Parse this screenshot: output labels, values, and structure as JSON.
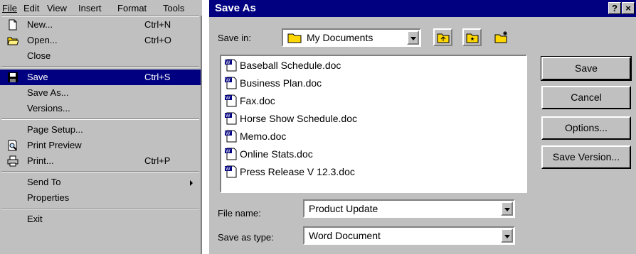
{
  "menubar": {
    "items": [
      "File",
      "Edit",
      "View",
      "Insert",
      "Format",
      "Tools"
    ]
  },
  "file_menu": {
    "items": [
      {
        "label": "New...",
        "shortcut": "Ctrl+N",
        "icon": "new-document-icon"
      },
      {
        "label": "Open...",
        "shortcut": "Ctrl+O",
        "icon": "open-folder-icon"
      },
      {
        "label": "Close",
        "shortcut": ""
      },
      {
        "label": "Save",
        "shortcut": "Ctrl+S",
        "icon": "floppy-disk-icon",
        "selected": true
      },
      {
        "label": "Save As...",
        "shortcut": ""
      },
      {
        "label": "Versions...",
        "shortcut": ""
      },
      {
        "label": "Page Setup...",
        "shortcut": ""
      },
      {
        "label": "Print Preview",
        "shortcut": "",
        "icon": "print-preview-icon"
      },
      {
        "label": "Print...",
        "shortcut": "Ctrl+P",
        "icon": "printer-icon"
      },
      {
        "label": "Send To",
        "shortcut": "",
        "submenu": true
      },
      {
        "label": "Properties",
        "shortcut": ""
      },
      {
        "label": "Exit",
        "shortcut": ""
      }
    ]
  },
  "dialog": {
    "title": "Save As",
    "help_button": "?",
    "close_button": "×",
    "save_in_label": "Save in:",
    "save_in_value": "My Documents",
    "files": [
      "Baseball Schedule.doc",
      "Business Plan.doc",
      "Fax.doc",
      "Horse Show Schedule.doc",
      "Memo.doc",
      "Online Stats.doc",
      "Press Release V 12.3.doc"
    ],
    "file_name_label": "File name:",
    "file_name_value": "Product Update",
    "save_type_label": "Save as type:",
    "save_type_value": "Word Document",
    "buttons": {
      "save": "Save",
      "cancel": "Cancel",
      "options": "Options...",
      "save_version": "Save Version..."
    }
  },
  "colors": {
    "menu_bg": "#c0c0c0",
    "selection": "#000080",
    "titlebar": "#000080"
  }
}
